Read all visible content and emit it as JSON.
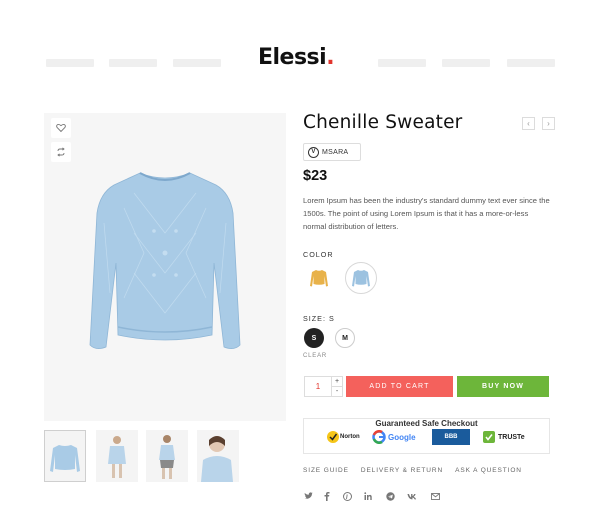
{
  "header": {
    "logo_text": "Elessi",
    "logo_dot": ".",
    "logo_dot_color": "#e2352d"
  },
  "gallery": {
    "wishlist_icon": "heart-icon",
    "compare_icon": "compare-arrows-icon",
    "thumbnail_count": 4
  },
  "product": {
    "title": "Chenille Sweater",
    "brand_letter": "V",
    "brand_name": "MSARA",
    "price": "$23",
    "description": "Lorem Ipsum has been the industry's standard dummy text ever since the 1500s. The point of using Lorem Ipsum is that it has a more-or-less normal distribution of letters.",
    "color_label": "COLOR",
    "colors": [
      {
        "name": "mustard",
        "hex": "#e8b24a"
      },
      {
        "name": "light-blue",
        "hex": "#9cc2e0"
      }
    ],
    "size_label": "SIZE: S",
    "sizes": [
      "S",
      "M"
    ],
    "clear_label": "CLEAR"
  },
  "purchase": {
    "quantity": "1",
    "plus": "+",
    "minus": "-",
    "add_to_cart": "ADD TO CART",
    "buy_now": "BUY NOW",
    "add_color": "#f4615c",
    "buy_color": "#6db63a"
  },
  "checkout": {
    "title": "Guaranteed Safe Checkout",
    "badges": [
      "Norton",
      "Google",
      "BBB",
      "TRUSTe"
    ]
  },
  "links": [
    "SIZE GUIDE",
    "DELIVERY & RETURN",
    "ASK A QUESTION"
  ],
  "social_icons": [
    "twitter-icon",
    "facebook-icon",
    "pinterest-icon",
    "linkedin-icon",
    "telegram-icon",
    "vk-icon",
    "email-icon"
  ]
}
